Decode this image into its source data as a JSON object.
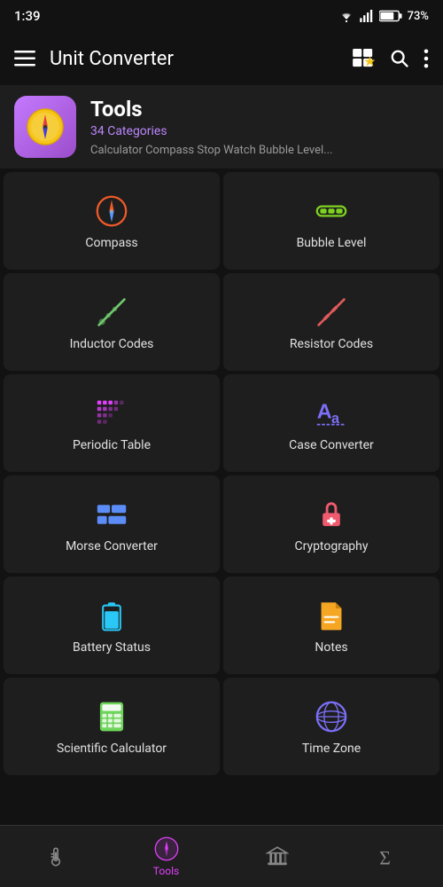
{
  "status": {
    "time": "1:39",
    "battery": "73%"
  },
  "header": {
    "menu_icon": "☰",
    "title": "Unit Converter",
    "grid_star_icon": "⊞★",
    "search_icon": "🔍",
    "more_icon": "⋮"
  },
  "category": {
    "title": "Tools",
    "count": "34 Categories",
    "description": "Calculator Compass Stop Watch Bubble Level..."
  },
  "grid_items": [
    {
      "id": "compass",
      "label": "Compass",
      "icon_color": "#f05a28",
      "icon_type": "compass"
    },
    {
      "id": "bubble-level",
      "label": "Bubble Level",
      "icon_color": "#7ed321",
      "icon_type": "bubble"
    },
    {
      "id": "inductor-codes",
      "label": "Inductor Codes",
      "icon_color": "#6ec86e",
      "icon_type": "inductor"
    },
    {
      "id": "resistor-codes",
      "label": "Resistor Codes",
      "icon_color": "#e05a5a",
      "icon_type": "resistor"
    },
    {
      "id": "periodic-table",
      "label": "Periodic Table",
      "icon_color": "#e040fb",
      "icon_type": "periodic"
    },
    {
      "id": "case-converter",
      "label": "Case Converter",
      "icon_color": "#7b6ff7",
      "icon_type": "case"
    },
    {
      "id": "morse-converter",
      "label": "Morse Converter",
      "icon_color": "#5b8cf7",
      "icon_type": "morse"
    },
    {
      "id": "cryptography",
      "label": "Cryptography",
      "icon_color": "#f05a6e",
      "icon_type": "crypto"
    },
    {
      "id": "battery-status",
      "label": "Battery Status",
      "icon_color": "#29c8f7",
      "icon_type": "battery"
    },
    {
      "id": "notes",
      "label": "Notes",
      "icon_color": "#f5a623",
      "icon_type": "notes"
    },
    {
      "id": "scientific-calculator",
      "label": "Scientific Calculator",
      "icon_color": "#6ed45b",
      "icon_type": "calculator"
    },
    {
      "id": "time-zone",
      "label": "Time Zone",
      "icon_color": "#7b6ff7",
      "icon_type": "globe"
    }
  ],
  "bottom_nav": [
    {
      "id": "thermometer",
      "label": "",
      "icon": "thermometer",
      "active": false
    },
    {
      "id": "tools",
      "label": "Tools",
      "icon": "compass-nav",
      "active": true
    },
    {
      "id": "bank",
      "label": "",
      "icon": "bank",
      "active": false
    },
    {
      "id": "sigma",
      "label": "",
      "icon": "sigma",
      "active": false
    }
  ]
}
